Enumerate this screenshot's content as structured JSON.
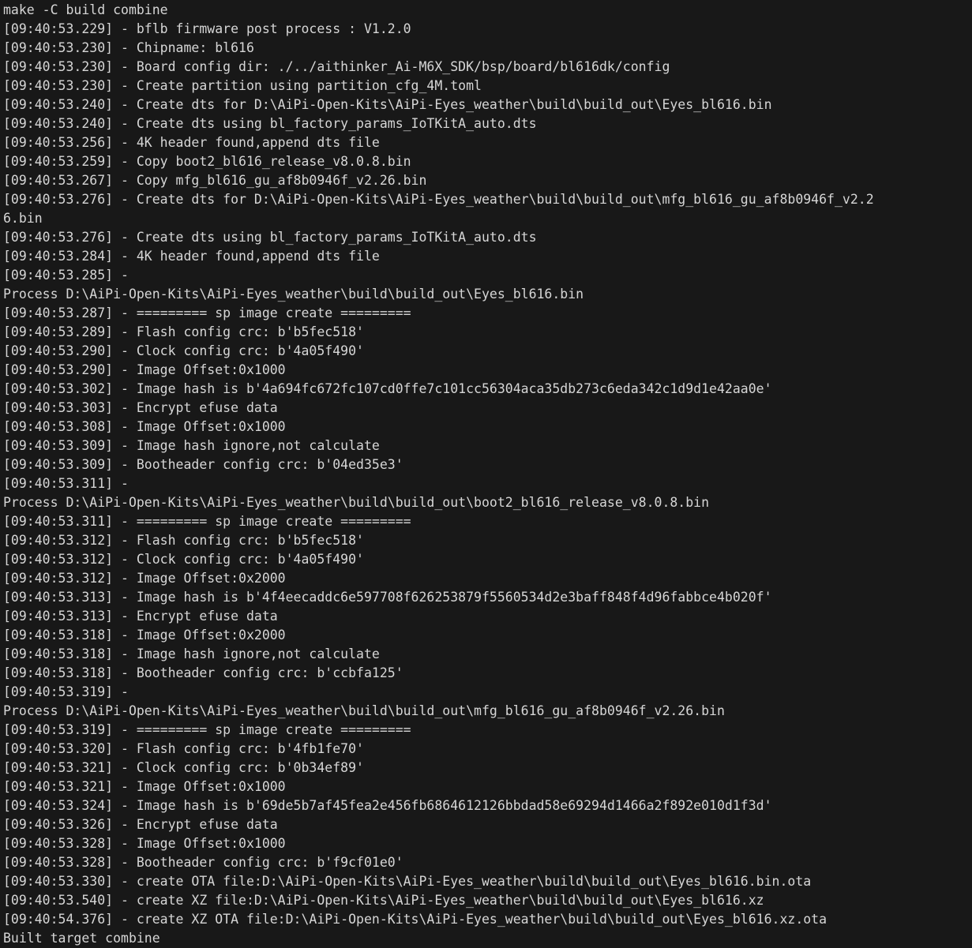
{
  "terminal": {
    "title": "make -C build combine",
    "background_color": "#181818",
    "text_color": "#d6d6d6",
    "command": "make -C build combine",
    "footer": "Built target combine",
    "lines": [
      "make -C build combine",
      "[09:40:53.229] - bflb firmware post process : V1.2.0",
      "[09:40:53.230] - Chipname: bl616",
      "[09:40:53.230] - Board config dir: ./../aithinker_Ai-M6X_SDK/bsp/board/bl616dk/config",
      "[09:40:53.230] - Create partition using partition_cfg_4M.toml",
      "[09:40:53.240] - Create dts for D:\\AiPi-Open-Kits\\AiPi-Eyes_weather\\build\\build_out\\Eyes_bl616.bin",
      "[09:40:53.240] - Create dts using bl_factory_params_IoTKitA_auto.dts",
      "[09:40:53.256] - 4K header found,append dts file",
      "[09:40:53.259] - Copy boot2_bl616_release_v8.0.8.bin",
      "[09:40:53.267] - Copy mfg_bl616_gu_af8b0946f_v2.26.bin",
      "[09:40:53.276] - Create dts for D:\\AiPi-Open-Kits\\AiPi-Eyes_weather\\build\\build_out\\mfg_bl616_gu_af8b0946f_v2.2",
      "6.bin",
      "[09:40:53.276] - Create dts using bl_factory_params_IoTKitA_auto.dts",
      "[09:40:53.284] - 4K header found,append dts file",
      "[09:40:53.285] - ",
      "Process D:\\AiPi-Open-Kits\\AiPi-Eyes_weather\\build\\build_out\\Eyes_bl616.bin",
      "[09:40:53.287] - ========= sp image create =========",
      "[09:40:53.289] - Flash config crc: b'b5fec518'",
      "[09:40:53.290] - Clock config crc: b'4a05f490'",
      "[09:40:53.290] - Image Offset:0x1000",
      "[09:40:53.302] - Image hash is b'4a694fc672fc107cd0ffe7c101cc56304aca35db273c6eda342c1d9d1e42aa0e'",
      "[09:40:53.303] - Encrypt efuse data",
      "[09:40:53.308] - Image Offset:0x1000",
      "[09:40:53.309] - Image hash ignore,not calculate",
      "[09:40:53.309] - Bootheader config crc: b'04ed35e3'",
      "[09:40:53.311] - ",
      "Process D:\\AiPi-Open-Kits\\AiPi-Eyes_weather\\build\\build_out\\boot2_bl616_release_v8.0.8.bin",
      "[09:40:53.311] - ========= sp image create =========",
      "[09:40:53.312] - Flash config crc: b'b5fec518'",
      "[09:40:53.312] - Clock config crc: b'4a05f490'",
      "[09:40:53.312] - Image Offset:0x2000",
      "[09:40:53.313] - Image hash is b'4f4eecaddc6e597708f626253879f5560534d2e3baff848f4d96fabbce4b020f'",
      "[09:40:53.313] - Encrypt efuse data",
      "[09:40:53.318] - Image Offset:0x2000",
      "[09:40:53.318] - Image hash ignore,not calculate",
      "[09:40:53.318] - Bootheader config crc: b'ccbfa125'",
      "[09:40:53.319] - ",
      "Process D:\\AiPi-Open-Kits\\AiPi-Eyes_weather\\build\\build_out\\mfg_bl616_gu_af8b0946f_v2.26.bin",
      "[09:40:53.319] - ========= sp image create =========",
      "[09:40:53.320] - Flash config crc: b'4fb1fe70'",
      "[09:40:53.321] - Clock config crc: b'0b34ef89'",
      "[09:40:53.321] - Image Offset:0x1000",
      "[09:40:53.324] - Image hash is b'69de5b7af45fea2e456fb6864612126bbdad58e69294d1466a2f892e010d1f3d'",
      "[09:40:53.326] - Encrypt efuse data",
      "[09:40:53.328] - Image Offset:0x1000",
      "[09:40:53.328] - Bootheader config crc: b'f9cf01e0'",
      "[09:40:53.330] - create OTA file:D:\\AiPi-Open-Kits\\AiPi-Eyes_weather\\build\\build_out\\Eyes_bl616.bin.ota",
      "[09:40:53.540] - create XZ file:D:\\AiPi-Open-Kits\\AiPi-Eyes_weather\\build\\build_out\\Eyes_bl616.xz",
      "[09:40:54.376] - create XZ OTA file:D:\\AiPi-Open-Kits\\AiPi-Eyes_weather\\build\\build_out\\Eyes_bl616.xz.ota",
      "Built target combine"
    ]
  }
}
